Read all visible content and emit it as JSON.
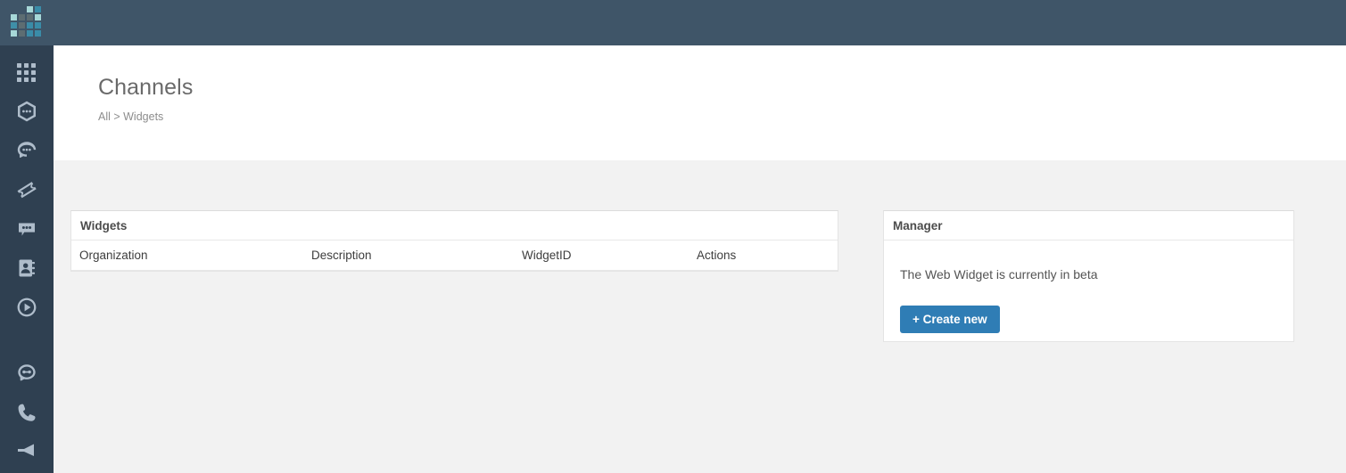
{
  "app": {
    "logo_name": "grid-logo",
    "topbar_color": "#3f5568",
    "sidebar_color": "#2f4051",
    "accent_color": "#2f7db5",
    "content_bg": "#f2f2f2"
  },
  "sidebar": {
    "items": [
      {
        "icon": "grid-icon",
        "name": "dashboard"
      },
      {
        "icon": "hexagon-chat-icon",
        "name": "conversations"
      },
      {
        "icon": "headset-chat-icon",
        "name": "support"
      },
      {
        "icon": "ticket-icon",
        "name": "tickets"
      },
      {
        "icon": "speech-bubble-icon",
        "name": "messages"
      },
      {
        "icon": "contacts-book-icon",
        "name": "contacts"
      },
      {
        "icon": "play-circle-icon",
        "name": "campaigns"
      },
      {
        "icon": "bot-headset-icon",
        "name": "bots"
      },
      {
        "icon": "phone-icon",
        "name": "voice"
      },
      {
        "icon": "megaphone-icon",
        "name": "broadcast"
      }
    ]
  },
  "header": {
    "title": "Channels",
    "breadcrumb": "All > Widgets"
  },
  "widgets_panel": {
    "title": "Widgets",
    "columns": [
      "Organization",
      "Description",
      "WidgetID",
      "Actions"
    ],
    "rows": []
  },
  "manager_panel": {
    "title": "Manager",
    "message": "The Web Widget is currently in beta",
    "create_button": "+ Create new"
  }
}
